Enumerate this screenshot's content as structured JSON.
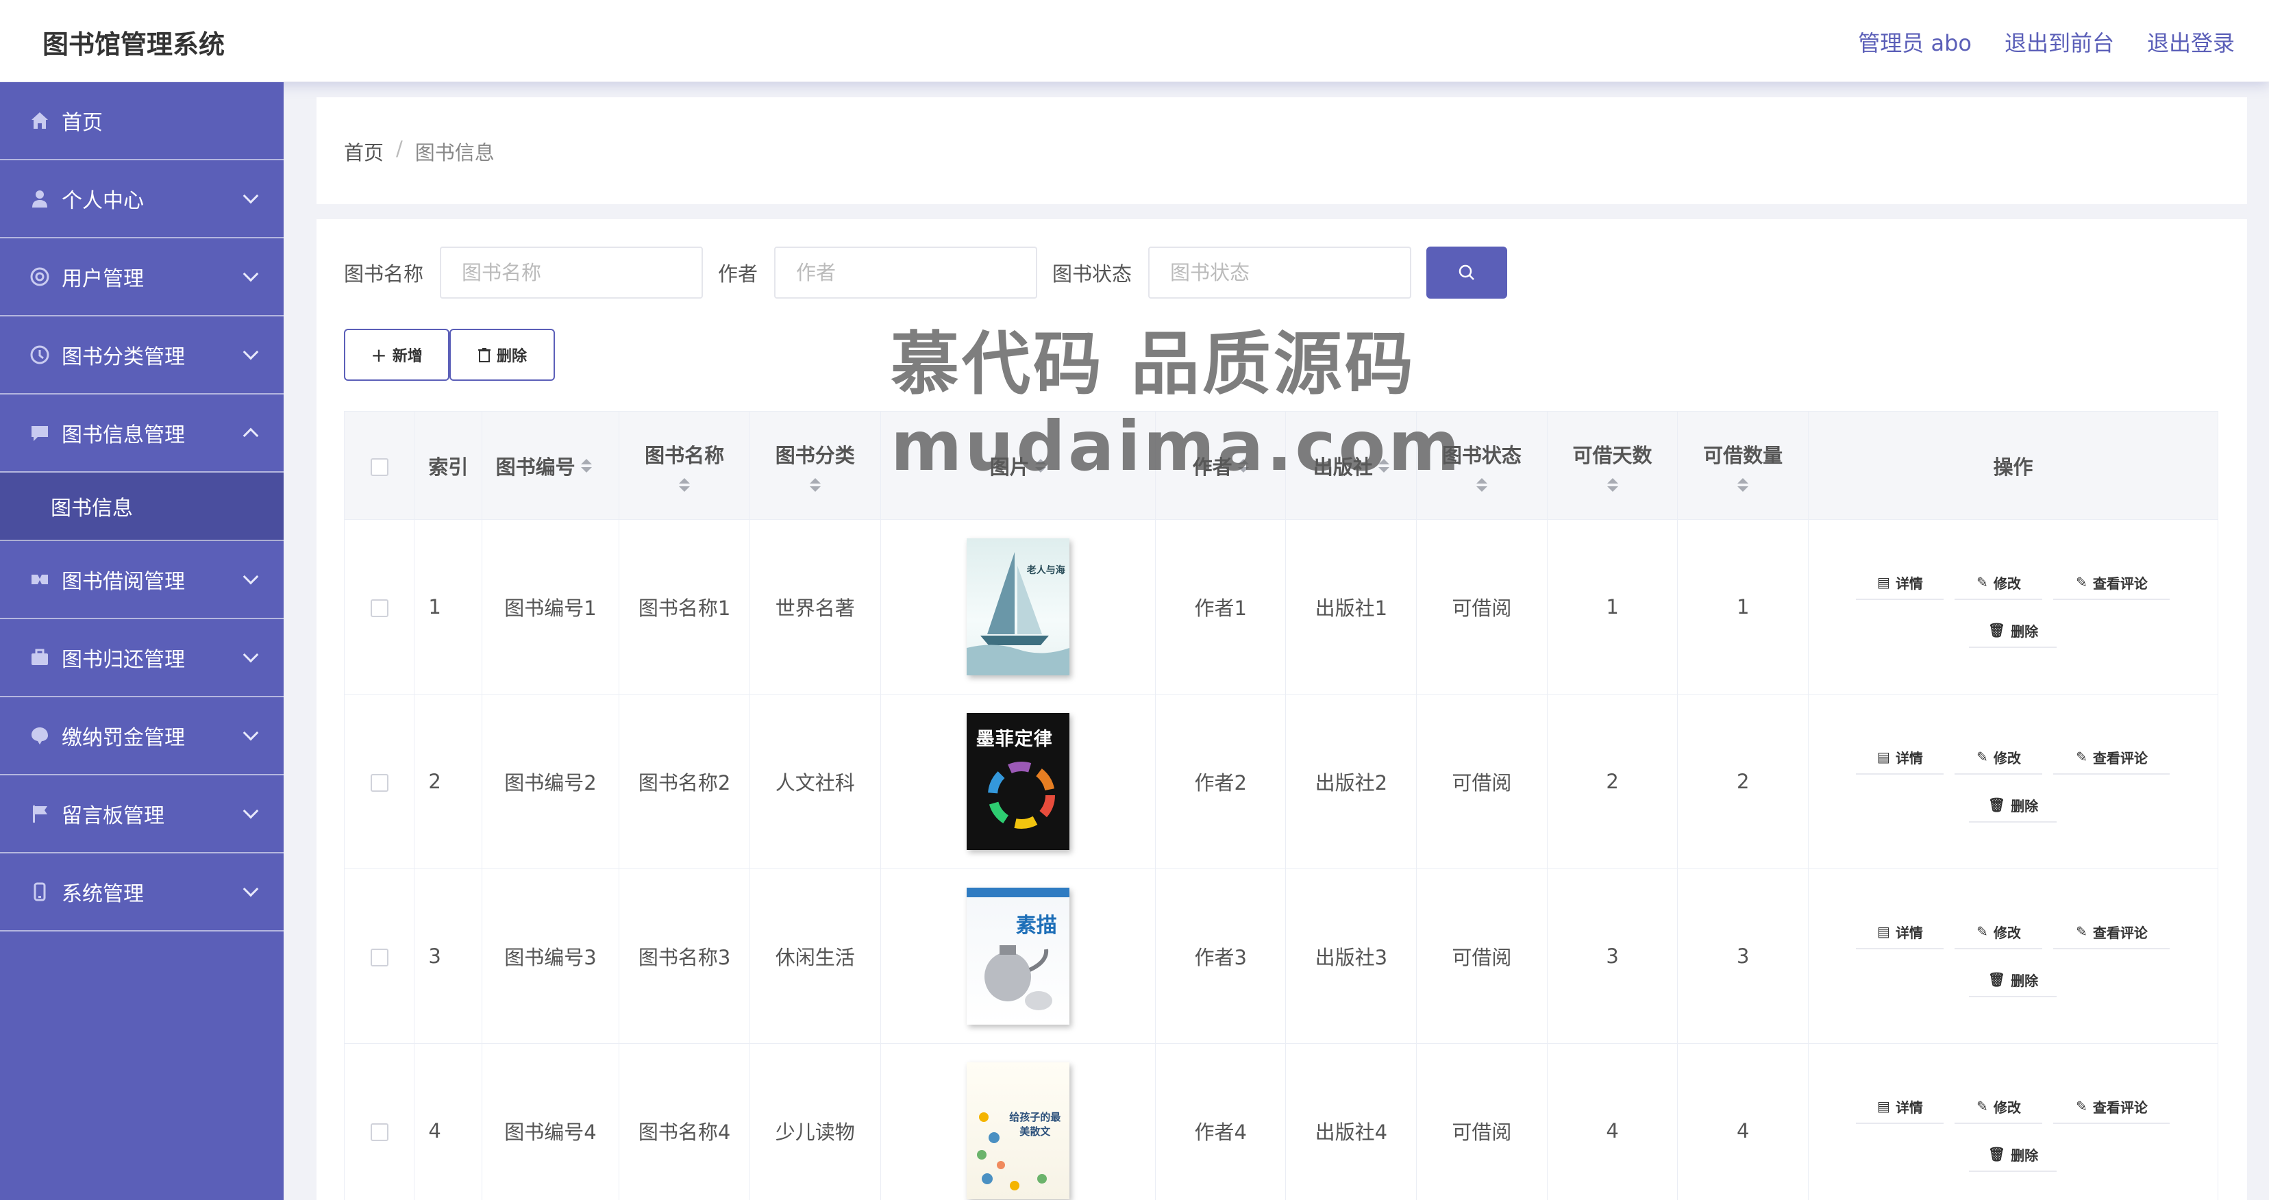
{
  "header": {
    "title": "图书馆管理系统",
    "links": [
      "管理员 abo",
      "退出到前台",
      "退出登录"
    ]
  },
  "sidebar": {
    "items": [
      {
        "label": "首页",
        "icon": "home-icon"
      },
      {
        "label": "个人中心",
        "icon": "user-icon"
      },
      {
        "label": "用户管理",
        "icon": "users-icon"
      },
      {
        "label": "图书分类管理",
        "icon": "category-icon"
      },
      {
        "label": "图书信息管理",
        "icon": "chat-icon"
      },
      {
        "label": "图书借阅管理",
        "icon": "borrow-icon"
      },
      {
        "label": "图书归还管理",
        "icon": "briefcase-icon"
      },
      {
        "label": "缴纳罚金管理",
        "icon": "fine-icon"
      },
      {
        "label": "留言板管理",
        "icon": "flag-icon"
      },
      {
        "label": "系统管理",
        "icon": "device-icon"
      }
    ],
    "active_sub": "图书信息"
  },
  "breadcrumb": {
    "home": "首页",
    "separator": "/",
    "current": "图书信息"
  },
  "search": {
    "fields": [
      {
        "label": "图书名称",
        "placeholder": "图书名称"
      },
      {
        "label": "作者",
        "placeholder": "作者"
      },
      {
        "label": "图书状态",
        "placeholder": "图书状态"
      }
    ]
  },
  "actions": {
    "add": "新增",
    "delete": "删除"
  },
  "table": {
    "headers": {
      "index": "索引",
      "code": "图书编号",
      "name": "图书名称",
      "category": "图书分类",
      "image": "图片",
      "author": "作者",
      "publisher": "出版社",
      "status": "图书状态",
      "days": "可借天数",
      "qty": "可借数量",
      "ops": "操作"
    },
    "rows": [
      {
        "index": "1",
        "code": "图书编号1",
        "name": "图书名称1",
        "category": "世界名著",
        "cover_title": "老人与海",
        "author": "作者1",
        "publisher": "出版社1",
        "status": "可借阅",
        "days": "1",
        "qty": "1"
      },
      {
        "index": "2",
        "code": "图书编号2",
        "name": "图书名称2",
        "category": "人文社科",
        "cover_title": "墨菲定律",
        "author": "作者2",
        "publisher": "出版社2",
        "status": "可借阅",
        "days": "2",
        "qty": "2"
      },
      {
        "index": "3",
        "code": "图书编号3",
        "name": "图书名称3",
        "category": "休闲生活",
        "cover_title": "素描",
        "author": "作者3",
        "publisher": "出版社3",
        "status": "可借阅",
        "days": "3",
        "qty": "3"
      },
      {
        "index": "4",
        "code": "图书编号4",
        "name": "图书名称4",
        "category": "少儿读物",
        "cover_title": "给孩子的最美散文",
        "author": "作者4",
        "publisher": "出版社4",
        "status": "可借阅",
        "days": "4",
        "qty": "4"
      }
    ],
    "ops": {
      "detail": "详情",
      "edit": "修改",
      "comments": "查看评论",
      "delete": "删除"
    }
  },
  "watermark": {
    "line1": "慕代码 品质源码",
    "line2": "mudaima.com"
  },
  "colors": {
    "accent": "#5b5fb8",
    "sidebar_active": "#4a4e9e"
  }
}
